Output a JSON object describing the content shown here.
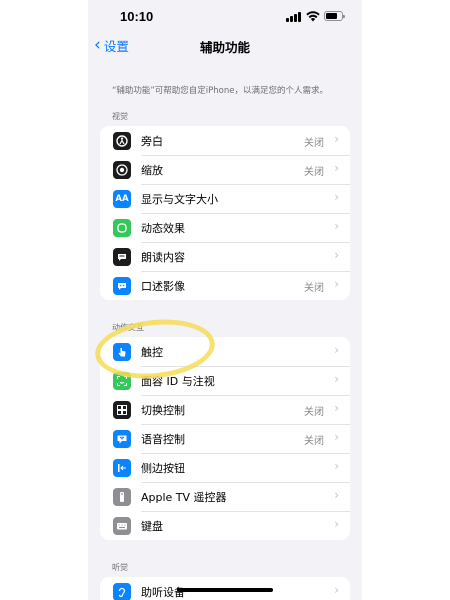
{
  "status": {
    "time": "10:10"
  },
  "nav": {
    "back_label": "设置",
    "title": "辅助功能"
  },
  "description": "“辅助功能”可帮助您自定iPhone，以满足您的个人需求。",
  "sections": {
    "vision": {
      "header": "视觉",
      "items": [
        {
          "label": "旁白",
          "value": "关闭",
          "icon": "voiceover-icon",
          "color": "#1c1c1e"
        },
        {
          "label": "缩放",
          "value": "关闭",
          "icon": "zoom-icon",
          "color": "#1c1c1e"
        },
        {
          "label": "显示与文字大小",
          "value": "",
          "icon": "text-size-icon",
          "color": "#0a84ff"
        },
        {
          "label": "动态效果",
          "value": "",
          "icon": "motion-icon",
          "color": "#34c759"
        },
        {
          "label": "朗读内容",
          "value": "",
          "icon": "spoken-content-icon",
          "color": "#1c1c1e"
        },
        {
          "label": "口述影像",
          "value": "关闭",
          "icon": "audio-description-icon",
          "color": "#0a84ff"
        }
      ]
    },
    "interaction": {
      "header": "动作交互",
      "items": [
        {
          "label": "触控",
          "value": "",
          "icon": "touch-icon",
          "color": "#0a84ff"
        },
        {
          "label": "面容 ID 与注视",
          "value": "",
          "icon": "face-id-icon",
          "color": "#34c759"
        },
        {
          "label": "切换控制",
          "value": "关闭",
          "icon": "switch-control-icon",
          "color": "#1c1c1e"
        },
        {
          "label": "语音控制",
          "value": "关闭",
          "icon": "voice-control-icon",
          "color": "#0a84ff"
        },
        {
          "label": "侧边按钮",
          "value": "",
          "icon": "side-button-icon",
          "color": "#0a84ff"
        },
        {
          "label": "Apple TV 遥控器",
          "value": "",
          "icon": "apple-tv-remote-icon",
          "color": "#8e8e93"
        },
        {
          "label": "键盘",
          "value": "",
          "icon": "keyboard-icon",
          "color": "#8e8e93"
        }
      ]
    },
    "hearing": {
      "header": "听觉",
      "items": [
        {
          "label": "助听设备",
          "value": "",
          "icon": "hearing-device-icon",
          "color": "#0a84ff"
        }
      ]
    }
  },
  "colors": {
    "accent": "#0a7aff",
    "highlight": "#f6dc58"
  }
}
